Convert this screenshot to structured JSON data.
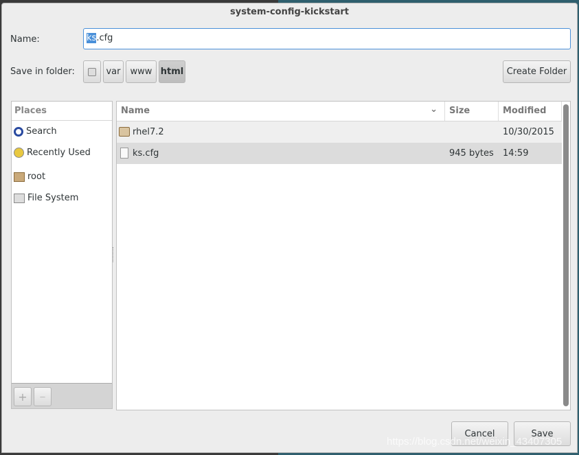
{
  "window": {
    "title": "system-config-kickstart"
  },
  "name_field": {
    "label": "Name:",
    "value_selected": "ks",
    "value_rest": ".cfg"
  },
  "folder": {
    "label": "Save in folder:",
    "path": [
      {
        "label": "",
        "icon": "drive-icon"
      },
      {
        "label": "var"
      },
      {
        "label": "www"
      },
      {
        "label": "html",
        "active": true
      }
    ],
    "create_folder": "Create Folder"
  },
  "places": {
    "header": "Places",
    "items": [
      {
        "label": "Search",
        "icon": "search-icon"
      },
      {
        "label": "Recently Used",
        "icon": "clock-icon"
      },
      {
        "label": "root",
        "icon": "home-folder-icon"
      },
      {
        "label": "File System",
        "icon": "drive-icon"
      }
    ],
    "add": "+",
    "remove": "—"
  },
  "files": {
    "columns": [
      "Name",
      "Size",
      "Modified"
    ],
    "rows": [
      {
        "name": "rhel7.2",
        "icon": "folder-icon",
        "size": "",
        "modified": "10/30/2015"
      },
      {
        "name": "ks.cfg",
        "icon": "file-icon",
        "size": "945 bytes",
        "modified": "14:59",
        "selected": true
      }
    ]
  },
  "actions": {
    "cancel": "Cancel",
    "save": "Save"
  },
  "watermark": "https://blog.csdn.net/weixin_43407305",
  "colors": {
    "accent": "#4a90d9",
    "selected_row": "#dcdcdc"
  }
}
